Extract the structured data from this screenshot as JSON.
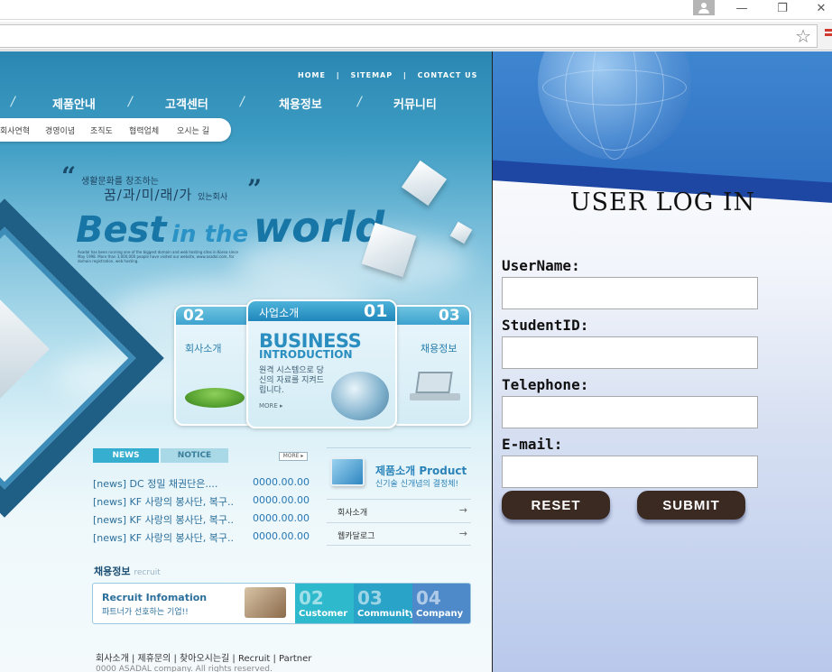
{
  "browser": {
    "star_glyph": "☆",
    "minimize_glyph": "—",
    "restore_glyph": "❐",
    "close_glyph": "✕"
  },
  "site": {
    "top_links": [
      "HOME",
      "|",
      "SITEMAP",
      "|",
      "CONTACT US"
    ],
    "main_nav": [
      "제품안내",
      "고객센터",
      "채용정보",
      "커뮤니티"
    ],
    "sub_nav": [
      "회사연혁",
      "경영이념",
      "조직도",
      "협력업체",
      "오시는 길"
    ],
    "slogan_line1": "생활문화를 창조하는",
    "slogan_line2": "꿈/과/미/래/가",
    "slogan_line2_suffix": "있는회사",
    "best_1": "Best",
    "best_2": "in the",
    "best_3": "world",
    "tiny_desc": "Asadal has been running one of the biggest domain and web hosting sites in Korea since May 1998. More than 3,000,000 people have visited our website, www.asadal.com, for domain registration, web hosting.",
    "cards": {
      "left": {
        "num": "02",
        "label": "회사소개"
      },
      "main": {
        "tab_label": "사업소개",
        "num": "01",
        "title": "BUSINESS",
        "subtitle": "INTRODUCTION",
        "desc": "원격 시스템으로 당신의 자료를 지켜드립니다.",
        "more": "MORE ▸"
      },
      "right": {
        "num": "03",
        "label": "채용정보"
      }
    },
    "news": {
      "tab_news": "NEWS",
      "tab_notice": "NOTICE",
      "more": "MORE ▸",
      "rows": [
        {
          "title": "[news] DC 정밀 채권단은....",
          "date": "0000.00.00"
        },
        {
          "title": "[news] KF 사랑의 봉사단, 복구..",
          "date": "0000.00.00"
        },
        {
          "title": "[news] KF 사랑의 봉사단, 복구..",
          "date": "0000.00.00"
        },
        {
          "title": "[news] KF 사랑의 봉사단, 복구..",
          "date": "0000.00.00"
        }
      ]
    },
    "product": {
      "title": "제품소개 Product",
      "subtitle": "신기술 신개념의 결정체!",
      "links": [
        {
          "label": "회사소개",
          "arrow": "→"
        },
        {
          "label": "웹카달로그",
          "arrow": "→"
        }
      ]
    },
    "recruit": {
      "heading": "채용정보",
      "heading_en": "recruit",
      "info_title": "Recruit Infomation",
      "info_sub": "파트너가 선호하는 기업!!",
      "boxes": [
        {
          "num": "02",
          "label": "Customer",
          "color": "#2fb9cc"
        },
        {
          "num": "03",
          "label": "Community",
          "color": "#29a3c8"
        },
        {
          "num": "04",
          "label": "Company",
          "color": "#4e89c9"
        }
      ]
    },
    "footer_links": "회사소개 | 제휴문의 | 찾아오시는길 | Recruit | Partner",
    "footer_copy": "0000 ASADAL company. All rights reserved."
  },
  "login": {
    "title": "USER LOG IN",
    "fields": [
      {
        "label": "UserName:",
        "value": ""
      },
      {
        "label": "StudentID:",
        "value": ""
      },
      {
        "label": "Telephone:",
        "value": ""
      },
      {
        "label": "E-mail:",
        "value": ""
      }
    ],
    "reset_label": "RESET",
    "submit_label": "SUBMIT"
  },
  "colors": {
    "button_bg": "#3a2a22",
    "banner_blue": "#2d6fc2",
    "news_tab": "#35aecf",
    "notice_tab": "#a9d9e6"
  }
}
